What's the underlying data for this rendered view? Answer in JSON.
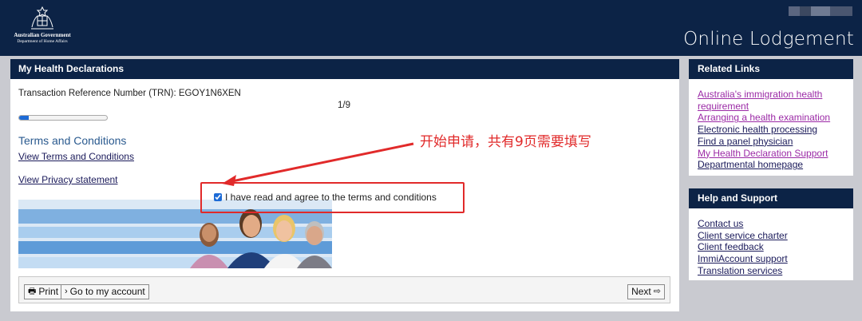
{
  "header": {
    "gov_line1": "Australian Government",
    "gov_line2": "Department of Home Affairs",
    "app_title": "Online Lodgement"
  },
  "main": {
    "panel_title": "My Health Declarations",
    "trn_text": "Transaction Reference Number (TRN): EGOY1N6XEN",
    "page_indicator": "1/9",
    "progress_fraction": 0.11,
    "terms_heading": "Terms and Conditions",
    "view_terms_link": "View Terms and Conditions",
    "view_privacy_link": "View Privacy statement",
    "agree_checkbox_label": "I have read and agree to the terms and conditions",
    "agree_checked": true
  },
  "footer": {
    "print_label": "Print",
    "account_label": "Go to my account",
    "next_label": "Next"
  },
  "related_links": {
    "title": "Related Links",
    "items": [
      "Australia's immigration health requirement",
      "Arranging a health examination",
      "Electronic health processing",
      "Find a panel physician",
      "My Health Declaration Support",
      "Departmental homepage"
    ]
  },
  "help_support": {
    "title": "Help and Support",
    "items": [
      "Contact us",
      "Client service charter",
      "Client feedback",
      "ImmiAccount support",
      "Translation services"
    ]
  },
  "annotation": {
    "text": "开始申请，共有9页需要填写",
    "color": "#e12a2a"
  },
  "colors": {
    "header_bg": "#0c2346",
    "page_bg": "#c9cad0",
    "link": "#1a1a5a",
    "visited_link": "#9b2aa6",
    "progress_fill": "#1d6bd6"
  }
}
